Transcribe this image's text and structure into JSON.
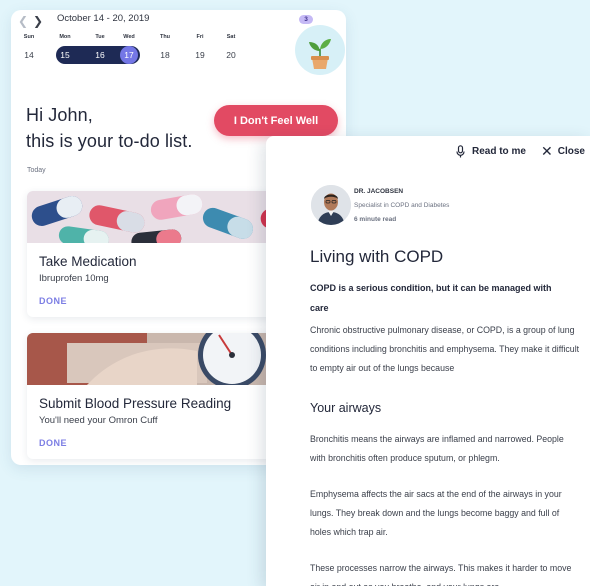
{
  "calendar": {
    "range_label": "October 14 - 20, 2019",
    "days": [
      {
        "name": "Sun",
        "num": "14"
      },
      {
        "name": "Mon",
        "num": "15"
      },
      {
        "name": "Tue",
        "num": "16"
      },
      {
        "name": "Wed",
        "num": "17"
      },
      {
        "name": "Thu",
        "num": "18"
      },
      {
        "name": "Fri",
        "num": "19"
      },
      {
        "name": "Sat",
        "num": "20"
      }
    ],
    "badge_count": "3"
  },
  "greeting": {
    "line1": "Hi John,",
    "line2": "this is your to-do list."
  },
  "feel_button_label": "I Don't Feel Well",
  "section_label": "Today",
  "tasks": [
    {
      "title": "Take Medication",
      "subtitle": "Ibruprofen 10mg",
      "status": "DONE"
    },
    {
      "title": "Submit Blood Pressure Reading",
      "subtitle": "You'll need your Omron Cuff",
      "status": "DONE"
    }
  ],
  "article": {
    "read_to_me_label": "Read to me",
    "close_label": "Close",
    "author_name": "DR. JACOBSEN",
    "author_role": "Specialist in COPD and Diabetes",
    "read_time": "6 minute read",
    "title": "Living with COPD",
    "lead": "COPD is a serious condition, but it can be managed with care",
    "paragraph1": "Chronic obstructive pulmonary disease, or COPD, is a group of lung conditions including bronchitis and emphysema. They make it difficult to empty air out of the lungs because",
    "subheading": "Your airways",
    "paragraph2": "Bronchitis means the airways are inflamed and narrowed. People with bronchitis often produce sputum, or phlegm.",
    "paragraph3": "Emphysema affects the air sacs at the end of the airways in your lungs. They break down and the lungs become baggy and full of holes which trap air.",
    "paragraph4": "These processes narrow the airways. This makes it harder to move air in and out as you breathe, and your lungs are"
  },
  "colors": {
    "accent_red": "#e24a63",
    "navy": "#1e2a55",
    "violet": "#7477e6",
    "done_purple": "#7c7ee4",
    "background": "#e2f5fb"
  },
  "icons": [
    "chevron-left-icon",
    "chevron-right-icon",
    "plant-icon",
    "microphone-icon",
    "close-icon"
  ]
}
